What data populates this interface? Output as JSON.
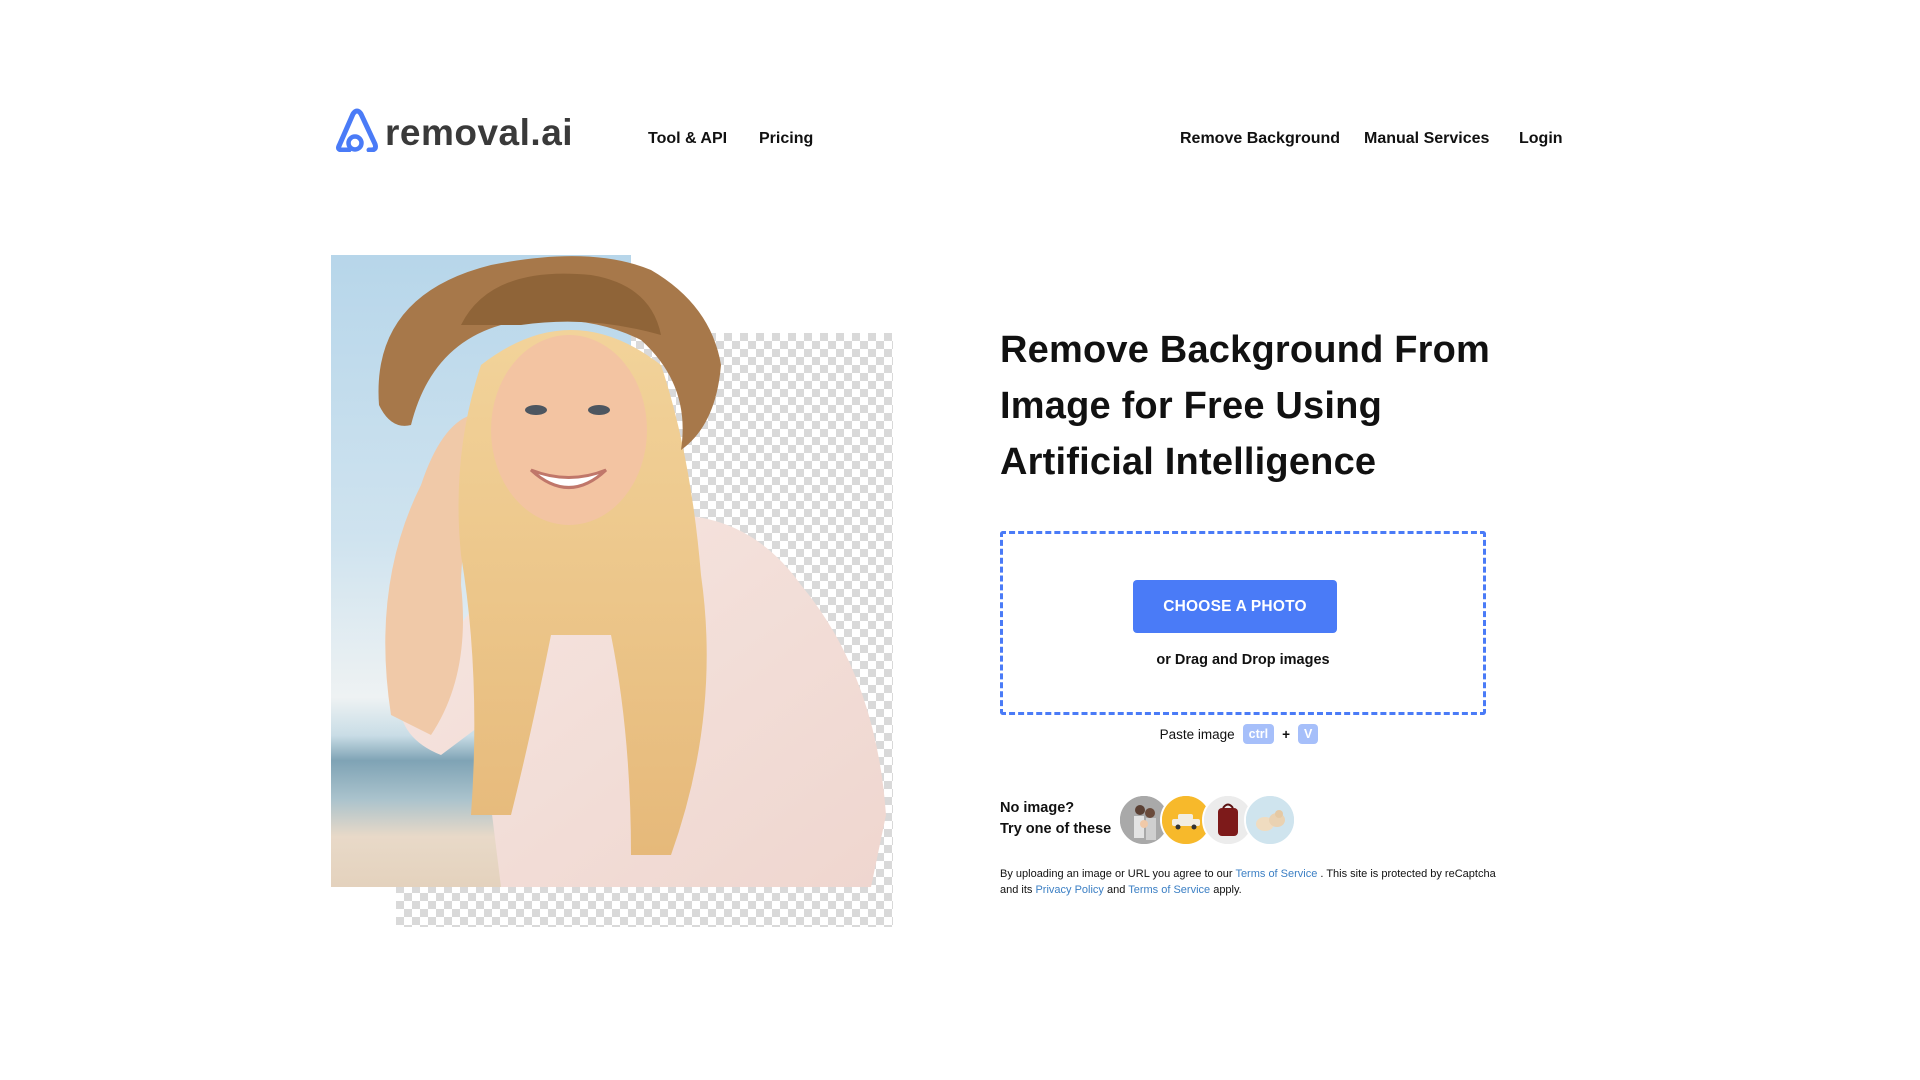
{
  "header": {
    "logo_text": "removal.ai",
    "nav_left": [
      {
        "label": "Tool & API"
      },
      {
        "label": "Pricing"
      }
    ],
    "nav_right": [
      {
        "label": "Remove Background"
      },
      {
        "label": "Manual Services"
      },
      {
        "label": "Login"
      }
    ]
  },
  "hero": {
    "image_alt": "Smiling woman in straw hat with background partially removed (transparency checkerboard)",
    "headline_lines": [
      "Remove Background From",
      "Image for Free Using",
      "Artificial Intelligence"
    ],
    "upload": {
      "button_label": "CHOOSE A PHOTO",
      "drag_text": "or Drag and Drop images"
    },
    "paste": {
      "label": "Paste image",
      "key1": "ctrl",
      "plus": "+",
      "key2": "V"
    },
    "samples": {
      "line1": "No image?",
      "line2": "Try one of these",
      "items": [
        {
          "name": "family-sample",
          "icon": "family-photo"
        },
        {
          "name": "car-sample",
          "icon": "car-photo"
        },
        {
          "name": "backpack-sample",
          "icon": "backpack-photo"
        },
        {
          "name": "dog-sample",
          "icon": "dogs-photo"
        }
      ]
    },
    "legal": {
      "t1": "By uploading an image or URL you agree to our ",
      "link1": "Terms of Service",
      "t2": " . This site is protected by reCaptcha and its ",
      "link2": "Privacy Policy",
      "t3": " and ",
      "link3": "Terms of Service",
      "t4": " apply."
    }
  },
  "colors": {
    "brand": "#4a7bf7",
    "key_badge": "#a6bffa",
    "link": "#3b7fc4",
    "text": "#111111",
    "logo_text": "#3a3a3a"
  }
}
